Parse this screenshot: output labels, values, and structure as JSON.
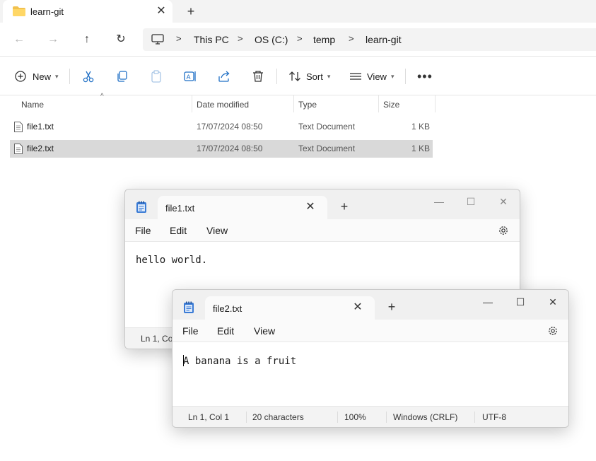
{
  "explorer": {
    "tab_title": "learn-git",
    "breadcrumbs": [
      "This PC",
      "OS (C:)",
      "temp",
      "learn-git"
    ],
    "toolbar": {
      "new_label": "New",
      "sort_label": "Sort",
      "view_label": "View"
    },
    "columns": [
      "Name",
      "Date modified",
      "Type",
      "Size"
    ],
    "files": [
      {
        "name": "file1.txt",
        "date": "17/07/2024 08:50",
        "type": "Text Document",
        "size": "1 KB",
        "selected": false
      },
      {
        "name": "file2.txt",
        "date": "17/07/2024 08:50",
        "type": "Text Document",
        "size": "1 KB",
        "selected": true
      }
    ]
  },
  "notepad1": {
    "tab_title": "file1.txt",
    "menu": [
      "File",
      "Edit",
      "View"
    ],
    "content": "hello world.",
    "status": {
      "position": "Ln 1, Col"
    }
  },
  "notepad2": {
    "tab_title": "file2.txt",
    "menu": [
      "File",
      "Edit",
      "View"
    ],
    "content": "A banana is a fruit",
    "status": {
      "position": "Ln 1, Col 1",
      "characters": "20 characters",
      "zoom": "100%",
      "line_ending": "Windows (CRLF)",
      "encoding": "UTF-8"
    }
  }
}
